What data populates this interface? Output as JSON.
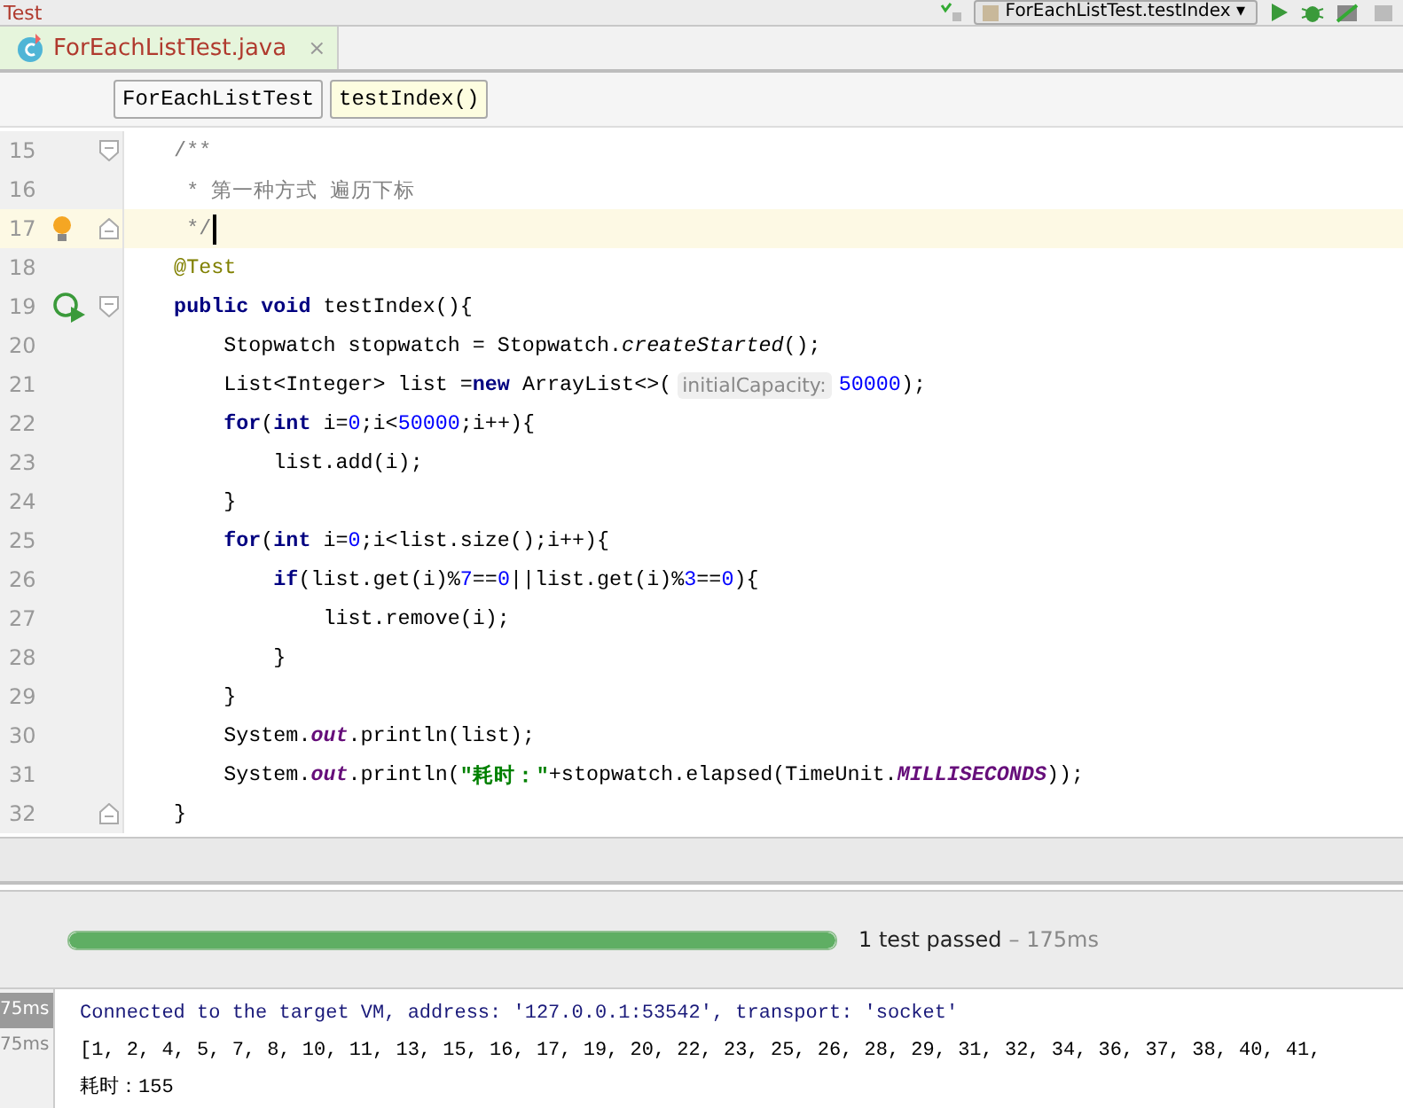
{
  "top_bar": {
    "project": "Test",
    "run_config": "ForEachListTest.testIndex",
    "dropdown_arrow": "▾"
  },
  "tabs": [
    {
      "label": "ForEachListTest.java",
      "close": "×",
      "selected": true
    }
  ],
  "breadcrumbs": [
    {
      "label": "ForEachListTest",
      "selected": false
    },
    {
      "label": "testIndex()",
      "selected": true
    }
  ],
  "editor": {
    "lines": [
      {
        "number": "15",
        "current": false,
        "cursor": false,
        "bulb": false,
        "run_icon": false,
        "fold_start": true,
        "fold_end": false,
        "tokens": [
          {
            "t": "    /**",
            "kind": "comment"
          }
        ]
      },
      {
        "number": "16",
        "current": false,
        "cursor": false,
        "bulb": false,
        "run_icon": false,
        "fold_start": false,
        "fold_end": false,
        "tokens": [
          {
            "t": "     * 第一种方式 遍历下标",
            "kind": "comment"
          }
        ]
      },
      {
        "number": "17",
        "current": true,
        "cursor": true,
        "bulb": true,
        "run_icon": false,
        "fold_start": false,
        "fold_end": true,
        "tokens": [
          {
            "t": "     */",
            "kind": "comment"
          }
        ]
      },
      {
        "number": "18",
        "current": false,
        "cursor": false,
        "bulb": false,
        "run_icon": false,
        "fold_start": false,
        "fold_end": false,
        "tokens": [
          {
            "t": "    @Test",
            "kind": "annotation"
          }
        ]
      },
      {
        "number": "19",
        "current": false,
        "cursor": false,
        "bulb": false,
        "run_icon": true,
        "fold_start": true,
        "fold_end": false,
        "tokens": [
          {
            "t": "    public",
            "kind": "keyword"
          },
          {
            "t": " void",
            "kind": "keyword"
          },
          {
            "t": " testIndex(){",
            "kind": "plain"
          }
        ]
      },
      {
        "number": "20",
        "current": false,
        "cursor": false,
        "bulb": false,
        "run_icon": false,
        "fold_start": false,
        "fold_end": false,
        "tokens": [
          {
            "t": "        Stopwatch stopwatch = Stopwatch.",
            "kind": "plain"
          },
          {
            "t": "createStarted",
            "kind": "italic"
          },
          {
            "t": "();",
            "kind": "plain"
          }
        ]
      },
      {
        "number": "21",
        "current": false,
        "cursor": false,
        "bulb": false,
        "run_icon": false,
        "fold_start": false,
        "fold_end": false,
        "tokens": [
          {
            "t": "        List<Integer> list =",
            "kind": "plain"
          },
          {
            "t": "new",
            "kind": "keyword"
          },
          {
            "t": " ArrayList<>(",
            "kind": "plain"
          },
          {
            "t": "initialCapacity:",
            "kind": "hint"
          },
          {
            "t": "50000",
            "kind": "number"
          },
          {
            "t": ");",
            "kind": "plain"
          }
        ]
      },
      {
        "number": "22",
        "current": false,
        "cursor": false,
        "bulb": false,
        "run_icon": false,
        "fold_start": false,
        "fold_end": false,
        "tokens": [
          {
            "t": "        for",
            "kind": "keyword"
          },
          {
            "t": "(",
            "kind": "plain"
          },
          {
            "t": "int",
            "kind": "keyword"
          },
          {
            "t": " i=",
            "kind": "plain"
          },
          {
            "t": "0",
            "kind": "number"
          },
          {
            "t": ";i<",
            "kind": "plain"
          },
          {
            "t": "50000",
            "kind": "number"
          },
          {
            "t": ";i++){",
            "kind": "plain"
          }
        ]
      },
      {
        "number": "23",
        "current": false,
        "cursor": false,
        "bulb": false,
        "run_icon": false,
        "fold_start": false,
        "fold_end": false,
        "tokens": [
          {
            "t": "            list.add(i);",
            "kind": "plain"
          }
        ]
      },
      {
        "number": "24",
        "current": false,
        "cursor": false,
        "bulb": false,
        "run_icon": false,
        "fold_start": false,
        "fold_end": false,
        "tokens": [
          {
            "t": "        }",
            "kind": "plain"
          }
        ]
      },
      {
        "number": "25",
        "current": false,
        "cursor": false,
        "bulb": false,
        "run_icon": false,
        "fold_start": false,
        "fold_end": false,
        "tokens": [
          {
            "t": "        for",
            "kind": "keyword"
          },
          {
            "t": "(",
            "kind": "plain"
          },
          {
            "t": "int",
            "kind": "keyword"
          },
          {
            "t": " i=",
            "kind": "plain"
          },
          {
            "t": "0",
            "kind": "number"
          },
          {
            "t": ";i<list.size();i++){",
            "kind": "plain"
          }
        ]
      },
      {
        "number": "26",
        "current": false,
        "cursor": false,
        "bulb": false,
        "run_icon": false,
        "fold_start": false,
        "fold_end": false,
        "tokens": [
          {
            "t": "            if",
            "kind": "keyword"
          },
          {
            "t": "(list.get(i)%",
            "kind": "plain"
          },
          {
            "t": "7",
            "kind": "number"
          },
          {
            "t": "==",
            "kind": "plain"
          },
          {
            "t": "0",
            "kind": "number"
          },
          {
            "t": "||list.get(i)%",
            "kind": "plain"
          },
          {
            "t": "3",
            "kind": "number"
          },
          {
            "t": "==",
            "kind": "plain"
          },
          {
            "t": "0",
            "kind": "number"
          },
          {
            "t": "){",
            "kind": "plain"
          }
        ]
      },
      {
        "number": "27",
        "current": false,
        "cursor": false,
        "bulb": false,
        "run_icon": false,
        "fold_start": false,
        "fold_end": false,
        "tokens": [
          {
            "t": "                list.remove(i);",
            "kind": "plain"
          }
        ]
      },
      {
        "number": "28",
        "current": false,
        "cursor": false,
        "bulb": false,
        "run_icon": false,
        "fold_start": false,
        "fold_end": false,
        "tokens": [
          {
            "t": "            }",
            "kind": "plain"
          }
        ]
      },
      {
        "number": "29",
        "current": false,
        "cursor": false,
        "bulb": false,
        "run_icon": false,
        "fold_start": false,
        "fold_end": false,
        "tokens": [
          {
            "t": "        }",
            "kind": "plain"
          }
        ]
      },
      {
        "number": "30",
        "current": false,
        "cursor": false,
        "bulb": false,
        "run_icon": false,
        "fold_start": false,
        "fold_end": false,
        "tokens": [
          {
            "t": "        System.",
            "kind": "plain"
          },
          {
            "t": "out",
            "kind": "static"
          },
          {
            "t": ".println(list);",
            "kind": "plain"
          }
        ]
      },
      {
        "number": "31",
        "current": false,
        "cursor": false,
        "bulb": false,
        "run_icon": false,
        "fold_start": false,
        "fold_end": false,
        "tokens": [
          {
            "t": "        System.",
            "kind": "plain"
          },
          {
            "t": "out",
            "kind": "static"
          },
          {
            "t": ".println(",
            "kind": "plain"
          },
          {
            "t": "\"耗时：\"",
            "kind": "string"
          },
          {
            "t": "+stopwatch.elapsed(TimeUnit.",
            "kind": "plain"
          },
          {
            "t": "MILLISECONDS",
            "kind": "static"
          },
          {
            "t": "));",
            "kind": "plain"
          }
        ]
      },
      {
        "number": "32",
        "current": false,
        "cursor": false,
        "bulb": false,
        "run_icon": false,
        "fold_start": false,
        "fold_end": true,
        "tokens": [
          {
            "t": "    }",
            "kind": "plain"
          }
        ]
      }
    ]
  },
  "test_results": {
    "level": 1.0,
    "status": "1 test passed",
    "duration": "– 175ms"
  },
  "console": {
    "times": [
      {
        "text": "75ms",
        "selected": true
      },
      {
        "text": "75ms",
        "selected": false
      }
    ],
    "lines": [
      {
        "kind": "info",
        "text": "Connected to the target VM, address: '127.0.0.1:53542', transport: 'socket'"
      },
      {
        "kind": "output",
        "text": "[1, 2, 4, 5, 7, 8, 10, 11, 13, 15, 16, 17, 19, 20, 22, 23, 25, 26, 28, 29, 31, 32, 34, 36, 37, 38, 40, 41,"
      },
      {
        "kind": "output",
        "text": "耗时：155"
      }
    ]
  }
}
